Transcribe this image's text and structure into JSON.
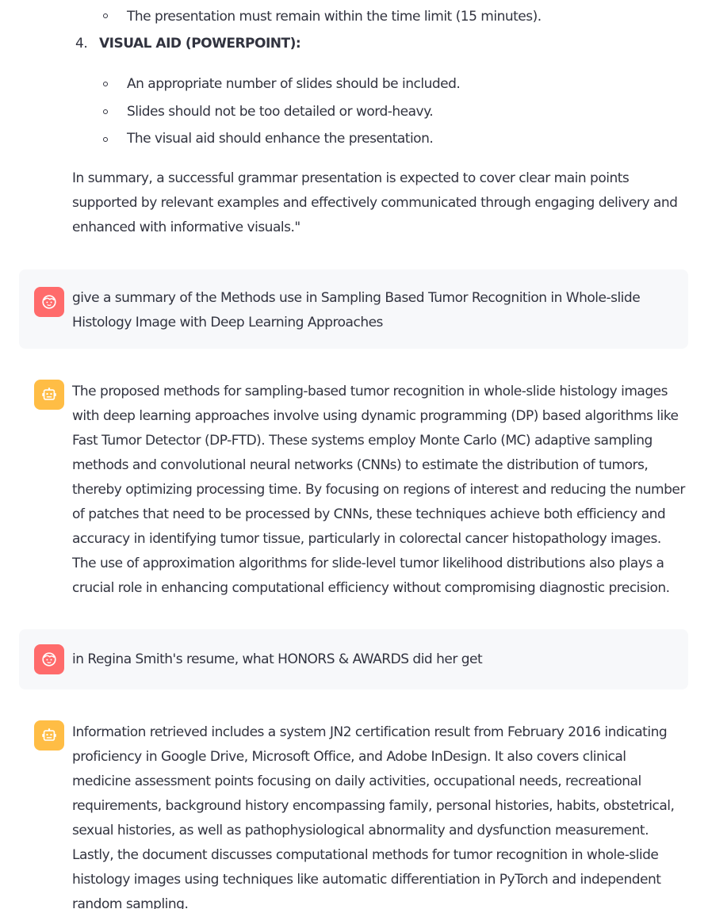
{
  "top_block": {
    "partial_bullet": "The presentation must remain within the time limit (15 minutes).",
    "ordered_item": {
      "number": "4.",
      "heading": "VISUAL AID (POWERPOINT):"
    },
    "sub_items": [
      "An appropriate number of slides should be included.",
      "Slides should not be too detailed or word-heavy.",
      "The visual aid should enhance the presentation."
    ],
    "summary": "In summary, a successful grammar presentation is expected to cover clear main points supported by relevant examples and effectively communicated through engaging delivery and enhanced with informative visuals.\""
  },
  "messages": [
    {
      "role": "user",
      "icon": "user-face-icon",
      "text": "give a summary of the Methods use in Sampling Based Tumor Recognition in Whole-slide Histology Image with Deep Learning Approaches"
    },
    {
      "role": "assistant",
      "icon": "robot-icon",
      "text": "The proposed methods for sampling-based tumor recognition in whole-slide histology images with deep learning approaches involve using dynamic programming (DP) based algorithms like Fast Tumor Detector (DP-FTD). These systems employ Monte Carlo (MC) adaptive sampling methods and convolutional neural networks (CNNs) to estimate the distribution of tumors, thereby optimizing processing time. By focusing on regions of interest and reducing the number of patches that need to be processed by CNNs, these techniques achieve both efficiency and accuracy in identifying tumor tissue, particularly in colorectal cancer histopathology images. The use of approximation algorithms for slide-level tumor likelihood distributions also plays a crucial role in enhancing computational efficiency without compromising diagnostic precision."
    },
    {
      "role": "user",
      "icon": "user-face-icon",
      "text": "in Regina Smith's resume, what HONORS & AWARDS did her get"
    },
    {
      "role": "assistant",
      "icon": "robot-icon",
      "text": "Information retrieved includes a system JN2 certification result from February 2016 indicating proficiency in Google Drive, Microsoft Office, and Adobe InDesign. It also covers clinical medicine assessment points focusing on daily activities, occupational needs, recreational requirements, background history encompassing family, personal histories, habits, obstetrical, sexual histories, as well as pathophysiological abnormality and dysfunction measurement. Lastly, the document discusses computational methods for tumor recognition in whole-slide histology images using techniques like automatic differentiation in PyTorch and independent random sampling."
    }
  ],
  "colors": {
    "text": "#31333f",
    "user_bg": "#f7f8fa",
    "user_avatar": "#ff6b6b",
    "assistant_avatar": "#ffbd45"
  }
}
